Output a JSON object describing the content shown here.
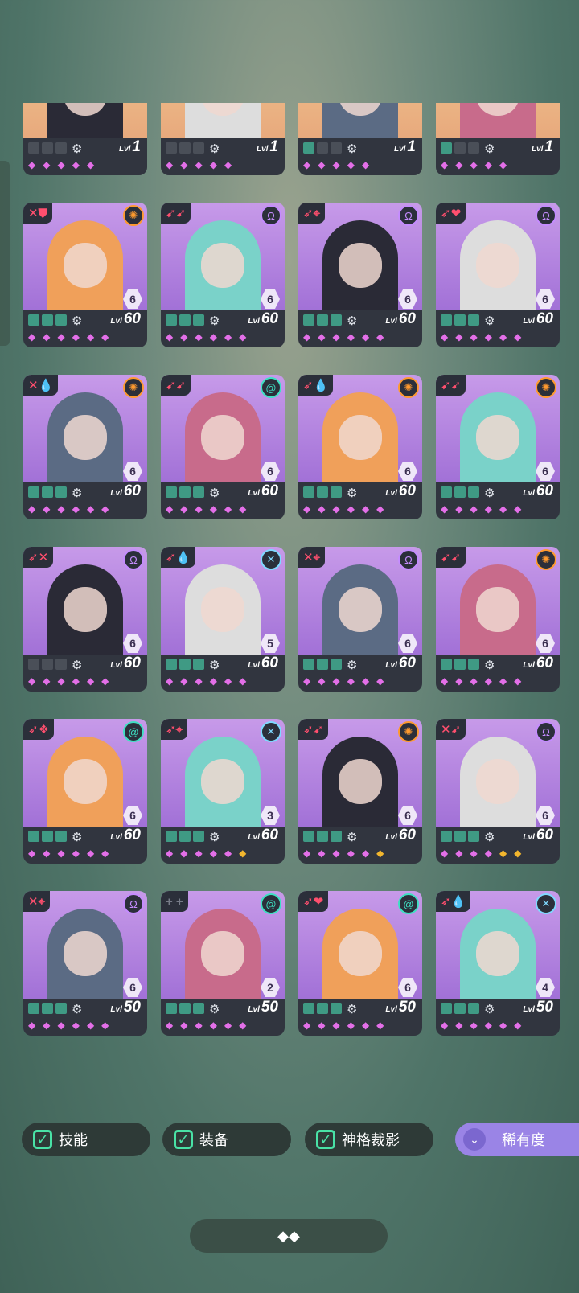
{
  "colors": {
    "accent_green": "#49e2a6",
    "purple_button": "#9a84e6",
    "gem_pink": "#e36fe8",
    "gem_gold": "#f2b62e"
  },
  "filters": {
    "skill_label": "技能",
    "equipment_label": "装备",
    "deity_label": "神格裁影",
    "rarity_label": "稀有度"
  },
  "cards": [
    {
      "level": "1",
      "stars": 6,
      "gold_count": 0,
      "slot_count": 0,
      "faction": "yellow-sun",
      "rank": "",
      "gem_count": 5,
      "class_icon": "plus"
    },
    {
      "level": "1",
      "stars": 6,
      "gold_count": 0,
      "slot_count": 0,
      "faction": "orange-sun",
      "rank": "",
      "gem_count": 5,
      "class_icon": "arrows"
    },
    {
      "level": "1",
      "stars": 6,
      "gold_count": 0,
      "slot_count": 1,
      "faction": "orange-sun",
      "rank": "",
      "gem_count": 5,
      "class_icon": "bolt"
    },
    {
      "level": "1",
      "stars": 6,
      "gold_count": 0,
      "slot_count": 1,
      "faction": "green-swirl",
      "rank": "",
      "gem_count": 5,
      "class_icon": "plus"
    },
    {
      "level": "60",
      "stars": 6,
      "gold_count": 0,
      "slot_count": 3,
      "faction": "orange-sun",
      "rank": "6",
      "gem_count": 6,
      "class_icon": "sword-shield"
    },
    {
      "level": "60",
      "stars": 6,
      "gold_count": 0,
      "slot_count": 3,
      "faction": "purple-omega",
      "rank": "6",
      "gem_count": 6,
      "class_icon": "arrows"
    },
    {
      "level": "60",
      "stars": 6,
      "gold_count": 0,
      "slot_count": 3,
      "faction": "purple-omega",
      "rank": "6",
      "gem_count": 6,
      "class_icon": "feather-target"
    },
    {
      "level": "60",
      "stars": 6,
      "gold_count": 0,
      "slot_count": 3,
      "faction": "purple-omega",
      "rank": "6",
      "gem_count": 6,
      "class_icon": "feather-hearts"
    },
    {
      "level": "60",
      "stars": 6,
      "gold_count": 0,
      "slot_count": 3,
      "faction": "orange-sun",
      "rank": "6",
      "gem_count": 6,
      "class_icon": "sword-drop"
    },
    {
      "level": "60",
      "stars": 6,
      "gold_count": 0,
      "slot_count": 3,
      "faction": "green-swirl",
      "rank": "6",
      "gem_count": 6,
      "class_icon": "arrows"
    },
    {
      "level": "60",
      "stars": 6,
      "gold_count": 0,
      "slot_count": 3,
      "faction": "orange-sun",
      "rank": "6",
      "gem_count": 6,
      "class_icon": "feather-drop"
    },
    {
      "level": "60",
      "stars": 6,
      "gold_count": 0,
      "slot_count": 3,
      "faction": "orange-sun",
      "rank": "6",
      "gem_count": 6,
      "class_icon": "arrows"
    },
    {
      "level": "60",
      "stars": 6,
      "gold_count": 0,
      "slot_count": 0,
      "faction": "purple-omega",
      "rank": "6",
      "gem_count": 6,
      "class_icon": "feather-sword"
    },
    {
      "level": "60",
      "stars": 6,
      "gold_count": 0,
      "slot_count": 3,
      "faction": "x-circle",
      "rank": "5",
      "gem_count": 6,
      "class_icon": "feather-drop"
    },
    {
      "level": "60",
      "stars": 6,
      "gold_count": 0,
      "slot_count": 3,
      "faction": "purple-omega",
      "rank": "6",
      "gem_count": 6,
      "class_icon": "sword-target"
    },
    {
      "level": "60",
      "stars": 6,
      "gold_count": 0,
      "slot_count": 3,
      "faction": "orange-sun",
      "rank": "6",
      "gem_count": 6,
      "class_icon": "arrows"
    },
    {
      "level": "60",
      "stars": 6,
      "gold_count": 0,
      "slot_count": 3,
      "faction": "green-swirl",
      "rank": "6",
      "gem_count": 6,
      "class_icon": "feather-triple"
    },
    {
      "level": "60",
      "stars": 6,
      "gold_count": 1,
      "slot_count": 3,
      "faction": "x-circle",
      "rank": "3",
      "gem_count": 6,
      "class_icon": "feather-target"
    },
    {
      "level": "60",
      "stars": 6,
      "gold_count": 1,
      "slot_count": 3,
      "faction": "orange-sun",
      "rank": "6",
      "gem_count": 6,
      "class_icon": "feather-arrows"
    },
    {
      "level": "60",
      "stars": 6,
      "gold_count": 2,
      "slot_count": 3,
      "faction": "purple-omega",
      "rank": "6",
      "gem_count": 6,
      "class_icon": "sword-arrows"
    },
    {
      "level": "50",
      "stars": 6,
      "gold_count": 0,
      "slot_count": 3,
      "faction": "purple-omega",
      "rank": "6",
      "gem_count": 6,
      "class_icon": "sword-target"
    },
    {
      "level": "50",
      "stars": 6,
      "gold_count": 0,
      "slot_count": 3,
      "faction": "green-swirl",
      "rank": "2",
      "gem_count": 6,
      "class_icon": "plus"
    },
    {
      "level": "50",
      "stars": 6,
      "gold_count": 0,
      "slot_count": 3,
      "faction": "green-swirl",
      "rank": "6",
      "gem_count": 6,
      "class_icon": "feather-hearts"
    },
    {
      "level": "50",
      "stars": 6,
      "gold_count": 0,
      "slot_count": 3,
      "faction": "x-circle",
      "rank": "4",
      "gem_count": 6,
      "class_icon": "feather-drop"
    }
  ]
}
